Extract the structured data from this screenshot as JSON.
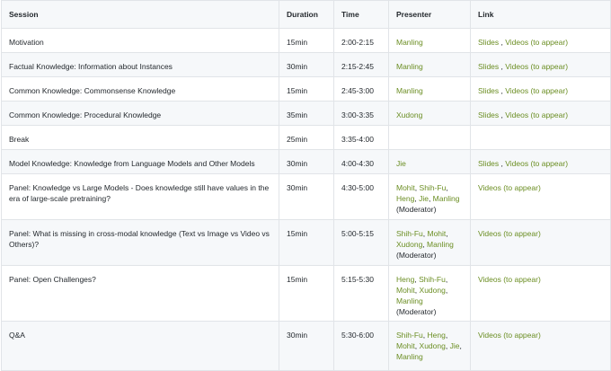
{
  "headers": {
    "session": "Session",
    "duration": "Duration",
    "time": "Time",
    "presenter": "Presenter",
    "link": "Link"
  },
  "rows": [
    {
      "session": "Motivation",
      "duration": "15min",
      "time": "2:00-2:15",
      "presenter": [
        {
          "text": "Manling",
          "link": true
        }
      ],
      "link": [
        {
          "text": "Slides",
          "link": true
        },
        {
          "text": " , ",
          "link": false
        },
        {
          "text": "Videos (to appear)",
          "link": true
        }
      ]
    },
    {
      "session": "Factual Knowledge: Information about Instances",
      "duration": "30min",
      "time": "2:15-2:45",
      "presenter": [
        {
          "text": "Manling",
          "link": true
        }
      ],
      "link": [
        {
          "text": "Slides",
          "link": true
        },
        {
          "text": " , ",
          "link": false
        },
        {
          "text": "Videos (to appear)",
          "link": true
        }
      ]
    },
    {
      "session": "Common Knowledge: Commonsense Knowledge",
      "duration": "15min",
      "time": "2:45-3:00",
      "presenter": [
        {
          "text": "Manling",
          "link": true
        }
      ],
      "link": [
        {
          "text": "Slides",
          "link": true
        },
        {
          "text": " , ",
          "link": false
        },
        {
          "text": "Videos (to appear)",
          "link": true
        }
      ]
    },
    {
      "session": "Common Knowledge: Procedural Knowledge",
      "duration": "35min",
      "time": "3:00-3:35",
      "presenter": [
        {
          "text": "Xudong",
          "link": true
        }
      ],
      "link": [
        {
          "text": "Slides",
          "link": true
        },
        {
          "text": " , ",
          "link": false
        },
        {
          "text": "Videos (to appear)",
          "link": true
        }
      ]
    },
    {
      "session": "Break",
      "duration": "25min",
      "time": "3:35-4:00",
      "presenter": [],
      "link": []
    },
    {
      "session": "Model Knowledge: Knowledge from Language Models and Other Models",
      "duration": "30min",
      "time": "4:00-4:30",
      "presenter": [
        {
          "text": "Jie",
          "link": true
        }
      ],
      "link": [
        {
          "text": "Slides",
          "link": true
        },
        {
          "text": " , ",
          "link": false
        },
        {
          "text": "Videos (to appear)",
          "link": true
        }
      ]
    },
    {
      "session": "Panel: Knowledge vs Large Models - Does knowledge still have values in the era of large-scale pretraining?",
      "duration": "30min",
      "time": "4:30-5:00",
      "presenter": [
        {
          "text": "Mohit",
          "link": true
        },
        {
          "text": ", ",
          "link": false
        },
        {
          "text": "Shih-Fu",
          "link": true
        },
        {
          "text": ", ",
          "link": false
        },
        {
          "text": "Heng",
          "link": true
        },
        {
          "text": ", ",
          "link": false
        },
        {
          "text": "Jie",
          "link": true
        },
        {
          "text": ", ",
          "link": false
        },
        {
          "text": "Manling",
          "link": true
        },
        {
          "text": " (Moderator)",
          "link": false
        }
      ],
      "link": [
        {
          "text": "Videos (to appear)",
          "link": true
        }
      ]
    },
    {
      "session": "Panel: What is missing in cross-modal knowledge (Text vs Image vs Video vs Others)?",
      "duration": "15min",
      "time": "5:00-5:15",
      "presenter": [
        {
          "text": "Shih-Fu",
          "link": true
        },
        {
          "text": ", ",
          "link": false
        },
        {
          "text": "Mohit",
          "link": true
        },
        {
          "text": ", ",
          "link": false
        },
        {
          "text": "Xudong",
          "link": true
        },
        {
          "text": ", ",
          "link": false
        },
        {
          "text": "Manling",
          "link": true
        },
        {
          "text": " (Moderator)",
          "link": false
        }
      ],
      "link": [
        {
          "text": "Videos (to appear)",
          "link": true
        }
      ]
    },
    {
      "session": "Panel: Open Challenges?",
      "duration": "15min",
      "time": "5:15-5:30",
      "presenter": [
        {
          "text": "Heng",
          "link": true
        },
        {
          "text": ", ",
          "link": false
        },
        {
          "text": "Shih-Fu",
          "link": true
        },
        {
          "text": ", ",
          "link": false
        },
        {
          "text": "Mohit",
          "link": true
        },
        {
          "text": ", ",
          "link": false
        },
        {
          "text": "Xudong",
          "link": true
        },
        {
          "text": ", ",
          "link": false
        },
        {
          "text": "Manling",
          "link": true
        },
        {
          "text": " (Moderator)",
          "link": false
        }
      ],
      "link": [
        {
          "text": "Videos (to appear)",
          "link": true
        }
      ]
    },
    {
      "session": "Q&A",
      "duration": "30min",
      "time": "5:30-6:00",
      "presenter": [
        {
          "text": "Shih-Fu",
          "link": true
        },
        {
          "text": ", ",
          "link": false
        },
        {
          "text": "Heng",
          "link": true
        },
        {
          "text": ", ",
          "link": false
        },
        {
          "text": "Mohit",
          "link": true
        },
        {
          "text": ", ",
          "link": false
        },
        {
          "text": "Xudong",
          "link": true
        },
        {
          "text": ", ",
          "link": false
        },
        {
          "text": "Jie",
          "link": true
        },
        {
          "text": ", ",
          "link": false
        },
        {
          "text": "Manling",
          "link": true
        }
      ],
      "link": [
        {
          "text": "Videos (to appear)",
          "link": true
        }
      ]
    }
  ],
  "colors": {
    "link": "#6b8e23",
    "header_bg": "#f6f8fa",
    "border": "#e1e4e8",
    "text": "#24292e"
  }
}
